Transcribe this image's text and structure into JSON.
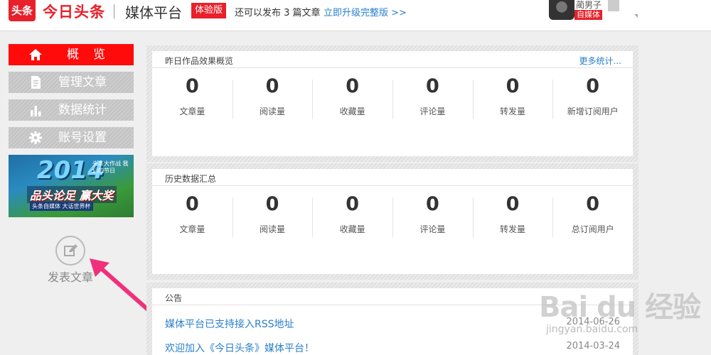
{
  "header": {
    "logo_badge": "头条",
    "logo_text": "今日头条",
    "platform_title": "媒体平台",
    "trial_badge": "体验版",
    "quota_text": "还可以发布 3 篇文章",
    "upgrade_link": "立即升级完整版 >>",
    "user_name": "蔺男子",
    "user_badge": "自媒体"
  },
  "sidebar": {
    "items": [
      {
        "label": "概览",
        "icon": "home-icon",
        "active": true
      },
      {
        "label": "管理文章",
        "icon": "document-icon",
        "active": false
      },
      {
        "label": "数据统计",
        "icon": "bar-chart-icon",
        "active": false
      },
      {
        "label": "账号设置",
        "icon": "gear-icon",
        "active": false
      }
    ],
    "promo": {
      "year": "2014",
      "subtitle": "头条大作战 我们的节日",
      "main": "品头论足 赢大奖",
      "tag": "头条自媒体 大话世界杯"
    },
    "publish_label": "发表文章"
  },
  "yesterday_panel": {
    "title": "昨日作品效果概览",
    "more_link": "更多统计...",
    "stats": [
      {
        "value": "0",
        "label": "文章量"
      },
      {
        "value": "0",
        "label": "阅读量"
      },
      {
        "value": "0",
        "label": "收藏量"
      },
      {
        "value": "0",
        "label": "评论量"
      },
      {
        "value": "0",
        "label": "转发量"
      },
      {
        "value": "0",
        "label": "新增订阅用户"
      }
    ]
  },
  "history_panel": {
    "title": "历史数据汇总",
    "stats": [
      {
        "value": "0",
        "label": "文章量"
      },
      {
        "value": "0",
        "label": "阅读量"
      },
      {
        "value": "0",
        "label": "收藏量"
      },
      {
        "value": "0",
        "label": "评论量"
      },
      {
        "value": "0",
        "label": "转发量"
      },
      {
        "value": "0",
        "label": "总订阅用户"
      }
    ]
  },
  "notice_panel": {
    "title": "公告",
    "items": [
      {
        "text": "媒体平台已支持接入RSS地址",
        "date": "2014-06-26"
      },
      {
        "text": "欢迎加入《今日头条》媒体平台！",
        "date": "2014-03-24"
      }
    ]
  },
  "watermark": {
    "main": "Bai du 经验",
    "sub": "jingyan.baidu.com"
  },
  "colors": {
    "brand_red": "#e8202a",
    "link_blue": "#2a7fc9",
    "arrow_pink": "#f0307a"
  }
}
